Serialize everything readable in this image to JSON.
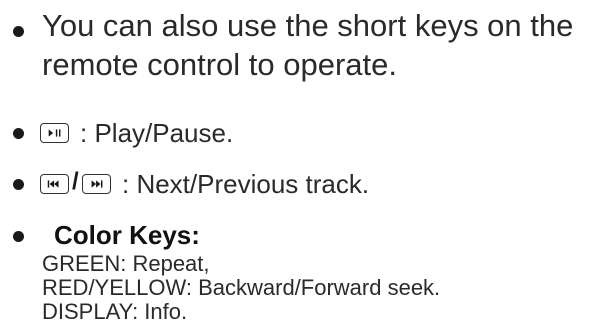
{
  "bullets": [
    {
      "lines": [
        "You can also use the short keys on the",
        "remote control to operate."
      ]
    },
    {
      "keys": [
        "play-pause-key"
      ],
      "text": ": Play/Pause."
    },
    {
      "keys": [
        "previous-track-key",
        "next-track-key"
      ],
      "separator": "/",
      "text": ": Next/Previous track."
    },
    {
      "heading": "Color Keys:",
      "lines": [
        "GREEN: Repeat,",
        "RED/YELLOW: Backward/Forward seek.",
        "DISPLAY: Info."
      ]
    }
  ]
}
